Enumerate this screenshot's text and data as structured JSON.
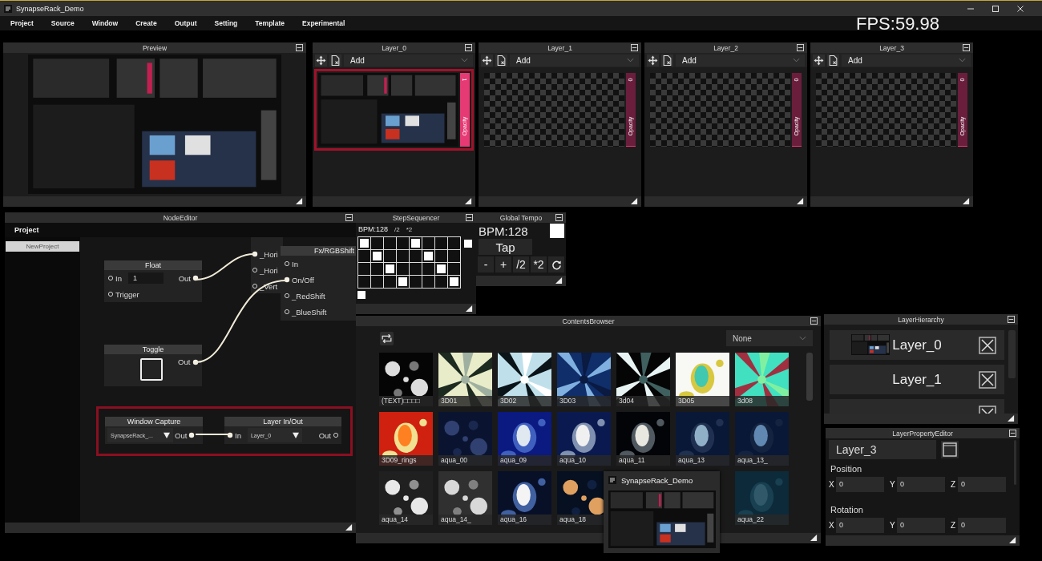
{
  "window": {
    "title": "SynapseRack_Demo"
  },
  "menu": [
    "Project",
    "Source",
    "Window",
    "Create",
    "Output",
    "Setting",
    "Template",
    "Experimental"
  ],
  "fps": "FPS:59.98",
  "preview": {
    "title": "Preview"
  },
  "layers": [
    {
      "title": "Layer_0",
      "blend": "Add",
      "selected": true,
      "kind": "picture",
      "opacity_value": "1",
      "opacity_label": "Opacity",
      "level": 1
    },
    {
      "title": "Layer_1",
      "blend": "Add",
      "selected": false,
      "kind": "empty",
      "opacity_value": "0",
      "opacity_label": "Opacity",
      "level": 0
    },
    {
      "title": "Layer_2",
      "blend": "Add",
      "selected": false,
      "kind": "empty",
      "opacity_value": "0",
      "opacity_label": "Opacity",
      "level": 0
    },
    {
      "title": "Layer_3",
      "blend": "Add",
      "selected": false,
      "kind": "empty",
      "opacity_value": "0",
      "opacity_label": "Opacity",
      "level": 0
    }
  ],
  "node_editor": {
    "title": "NodeEditor",
    "sidebar_header": "Project",
    "projects": [
      "NewProject"
    ],
    "highlight_frame": true,
    "nodes": [
      {
        "kind": "float",
        "title": "Float",
        "inputs": [
          {
            "label": "In",
            "connected": false,
            "value": "1"
          },
          {
            "label": "Trigger",
            "connected": false
          }
        ],
        "outputs": [
          {
            "label": "Out",
            "connected": true
          }
        ]
      },
      {
        "kind": "toggle",
        "title": "Toggle",
        "checked": false,
        "outputs": [
          {
            "label": "Out",
            "connected": true
          }
        ]
      },
      {
        "kind": "source_select",
        "title": "Window Capture",
        "value": "SynapseRack_...",
        "outputs": [
          {
            "label": "Out",
            "connected": true
          }
        ]
      },
      {
        "kind": "layer_io",
        "title": "Layer In/Out",
        "value": "Layer_0",
        "inputs": [
          {
            "label": "In",
            "connected": true
          }
        ],
        "outputs": [
          {
            "label": "Out",
            "connected": false
          }
        ]
      },
      {
        "kind": "param_list",
        "inputs": [
          {
            "label": "_Hori",
            "connected": true
          },
          {
            "label": "_Hori",
            "connected": false
          },
          {
            "label": "_Vert",
            "connected": false
          }
        ]
      },
      {
        "kind": "effect",
        "title": "Fx/RGBShift",
        "inputs": [
          {
            "label": "In",
            "connected": false
          },
          {
            "label": "On/Off",
            "connected": true
          },
          {
            "label": "_RedShift",
            "connected": false
          },
          {
            "label": "_BlueShift",
            "connected": false
          }
        ]
      }
    ]
  },
  "sequencer": {
    "title": "StepSequencer",
    "bpm": "BPM:128",
    "half": "/2",
    "double": "*2",
    "steps": [
      [
        true,
        false,
        false,
        false,
        true,
        false,
        false,
        false
      ],
      [
        false,
        true,
        false,
        false,
        false,
        true,
        false,
        false
      ],
      [
        false,
        false,
        true,
        false,
        false,
        false,
        true,
        false
      ],
      [
        false,
        false,
        false,
        true,
        false,
        false,
        false,
        true
      ]
    ],
    "side_toggle": true,
    "bottom_toggle": true
  },
  "tempo": {
    "title": "Global Tempo",
    "bpm": "BPM:128",
    "beat_on": true,
    "tap": "Tap",
    "buttons": [
      "-",
      "+",
      "/2",
      "*2"
    ]
  },
  "contents": {
    "title": "ContentsBrowser",
    "filter": "None",
    "items": [
      {
        "label": "(TEXT)□□□□"
      },
      {
        "label": "3D01"
      },
      {
        "label": "3D02"
      },
      {
        "label": "3D03"
      },
      {
        "label": "3d04"
      },
      {
        "label": "3D05"
      },
      {
        "label": "3d08"
      },
      {
        "label": "3D09_rings"
      },
      {
        "label": "aqua_00"
      },
      {
        "label": "aqua_09"
      },
      {
        "label": "aqua_10"
      },
      {
        "label": "aqua_11"
      },
      {
        "label": "aqua_13"
      },
      {
        "label": "aqua_13_"
      },
      {
        "label": "aqua_14"
      },
      {
        "label": "aqua_14_"
      },
      {
        "label": "aqua_16"
      },
      {
        "label": "aqua_18"
      },
      {
        "label": "aqua_22"
      }
    ]
  },
  "popup": {
    "title": "SynapseRack_Demo"
  },
  "hierarchy": {
    "title": "LayerHierarchy",
    "items": [
      {
        "label": "Layer_0",
        "thumbnail": true
      },
      {
        "label": "Layer_1",
        "thumbnail": false
      }
    ]
  },
  "property_editor": {
    "title": "LayerPropertyEditor",
    "name": "Layer_3",
    "sections": [
      {
        "label": "Position",
        "fields": [
          {
            "axis": "X",
            "value": "0"
          },
          {
            "axis": "Y",
            "value": "0"
          },
          {
            "axis": "Z",
            "value": "0"
          }
        ]
      },
      {
        "label": "Rotation",
        "fields": [
          {
            "axis": "X",
            "value": "0"
          },
          {
            "axis": "Y",
            "value": "0"
          },
          {
            "axis": "Z",
            "value": "0"
          }
        ]
      }
    ]
  }
}
